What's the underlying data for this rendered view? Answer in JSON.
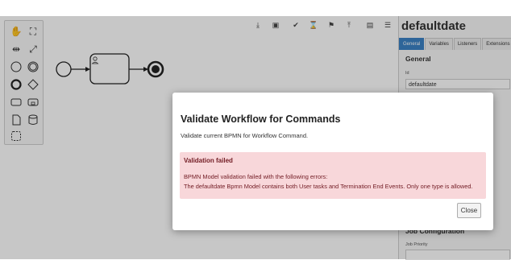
{
  "properties_panel": {
    "title": "defaultdate",
    "tabs": [
      {
        "label": "General",
        "active": true
      },
      {
        "label": "Variables",
        "active": false
      },
      {
        "label": "Listeners",
        "active": false
      },
      {
        "label": "Extensions",
        "active": false
      }
    ],
    "section_general": "General",
    "id_label": "Id",
    "id_value": "defaultdate",
    "section_job": "Job Configuration",
    "job_priority_label": "Job Priority"
  },
  "toolbar": {
    "icons": [
      "download-icon",
      "image-icon",
      "check-icon",
      "hourglass-icon",
      "deploy-icon",
      "upload-icon",
      "save-icon",
      "list-icon"
    ]
  },
  "palette": {
    "tools": [
      "hand-tool-icon",
      "lasso-tool-icon",
      "space-tool-icon",
      "global-connect-icon",
      "start-event-icon",
      "intermediate-event-icon",
      "end-event-icon",
      "gateway-icon",
      "task-icon",
      "subprocess-icon",
      "data-object-icon",
      "data-store-icon",
      "group-icon"
    ]
  },
  "modal": {
    "title": "Validate Workflow for Commands",
    "description": "Validate current BPMN for Workflow Command.",
    "alert_title": "Validation failed",
    "alert_line1": "BPMN Model validation failed with the following errors:",
    "alert_line2": "The defaultdate Bpmn Model contains both User tasks and Termination End Events. Only one type is allowed.",
    "close_label": "Close"
  },
  "colors": {
    "alert_bg": "#f8d7da",
    "alert_text": "#721c24",
    "tab_active": "#3b82c4"
  }
}
